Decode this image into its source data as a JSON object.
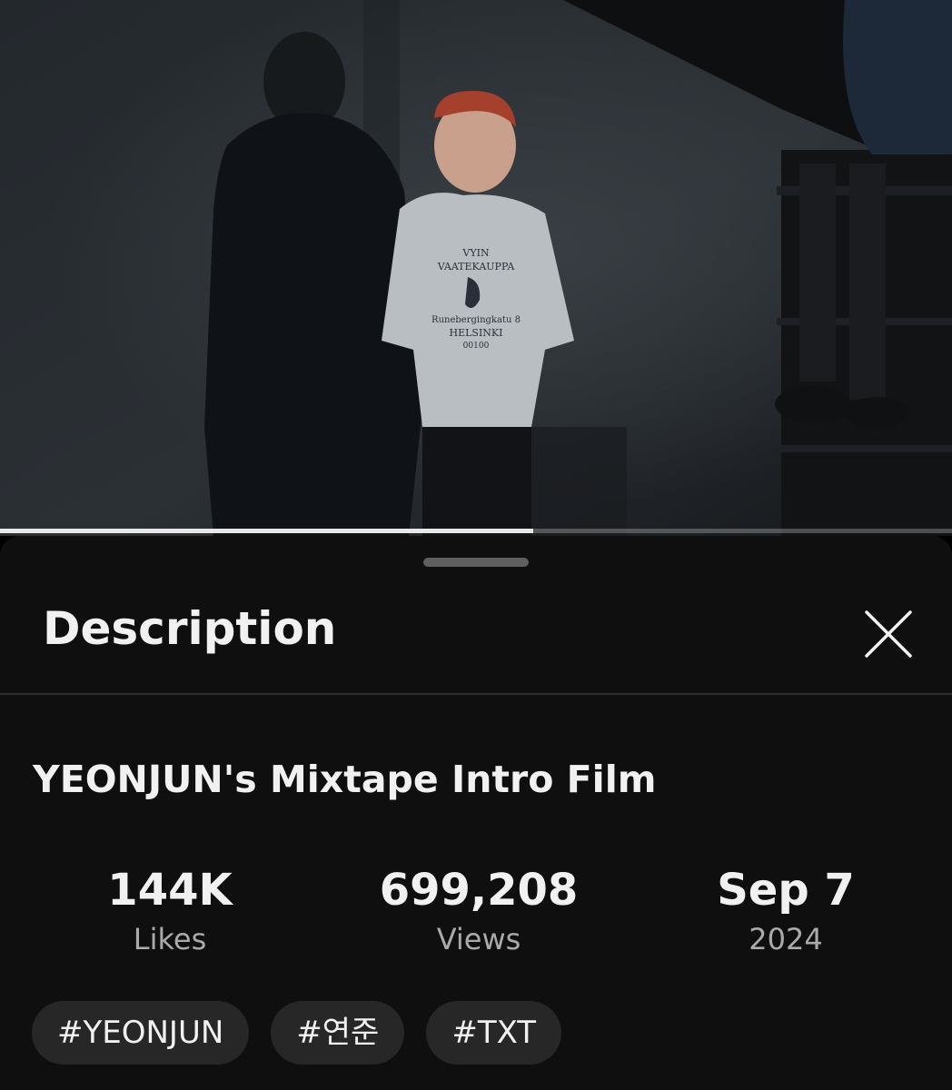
{
  "video": {
    "progress_fraction": 0.56
  },
  "sheet": {
    "title": "Description",
    "close_icon": "close-icon"
  },
  "details": {
    "title": "YEONJUN's Mixtape Intro Film",
    "stats": [
      {
        "value": "144K",
        "label": "Likes"
      },
      {
        "value": "699,208",
        "label": "Views"
      },
      {
        "value": "Sep 7",
        "label": "2024"
      }
    ],
    "tags": [
      "#YEONJUN",
      "#연준",
      "#TXT"
    ]
  },
  "colors": {
    "sheet_background": "#0f0f0f",
    "tag_background": "#272727",
    "secondary_text": "#aaaaaa"
  }
}
